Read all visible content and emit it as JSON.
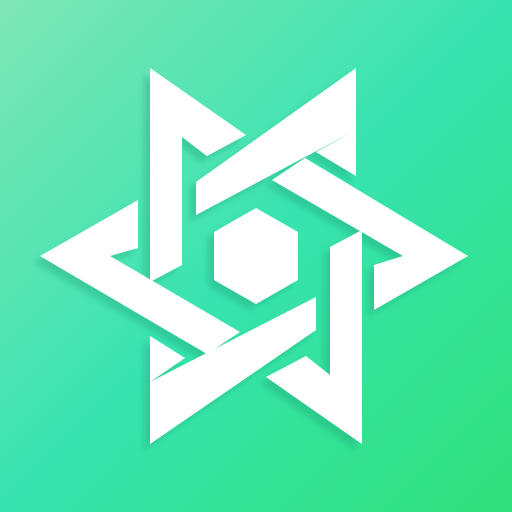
{
  "icon": {
    "name": "interlaced-hexagram-logo",
    "colors": {
      "gradient_top_left": "#7FE6B6",
      "gradient_mid": "#38E3B0",
      "gradient_bottom_right": "#2FE07A",
      "emblem": "#FFFFFF",
      "shadow": "#1F9E74"
    }
  }
}
